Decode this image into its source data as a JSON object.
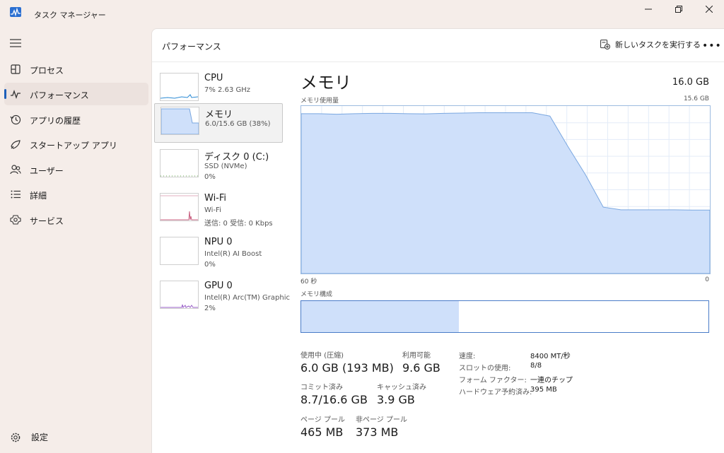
{
  "window": {
    "title": "タスク マネージャー",
    "controls": [
      "minimize-icon",
      "restore-icon",
      "close-icon"
    ]
  },
  "sidebar": {
    "items": [
      {
        "label": "プロセス",
        "icon": "processes-icon"
      },
      {
        "label": "パフォーマンス",
        "icon": "performance-icon"
      },
      {
        "label": "アプリの履歴",
        "icon": "history-icon"
      },
      {
        "label": "スタートアップ アプリ",
        "icon": "startup-icon"
      },
      {
        "label": "ユーザー",
        "icon": "users-icon"
      },
      {
        "label": "詳細",
        "icon": "details-icon"
      },
      {
        "label": "サービス",
        "icon": "services-icon"
      }
    ],
    "active_index": 1,
    "settings_label": "設定"
  },
  "header": {
    "title": "パフォーマンス",
    "new_task_label": "新しいタスクを実行する",
    "more_label": "•••"
  },
  "resources": [
    {
      "name": "CPU",
      "sub": "7%  2.63 GHz",
      "sub2": ""
    },
    {
      "name": "メモリ",
      "sub": "6.0/15.6 GB (38%)",
      "sub2": ""
    },
    {
      "name": "ディスク 0 (C:)",
      "sub": "SSD (NVMe)",
      "sub2": "0%"
    },
    {
      "name": "Wi-Fi",
      "sub": "Wi-Fi",
      "sub2": "送信: 0  受信: 0 Kbps"
    },
    {
      "name": "NPU 0",
      "sub": "Intel(R) AI Boost",
      "sub2": "0%"
    },
    {
      "name": "GPU 0",
      "sub": "Intel(R) Arc(TM) Graphic",
      "sub2": "2%"
    }
  ],
  "detail": {
    "title": "メモリ",
    "total": "16.0 GB",
    "usage_label": "メモリ使用量",
    "usage_max": "15.6 GB",
    "x_left": "60 秒",
    "x_right": "0",
    "composition_label": "メモリ構成",
    "usage_series": [
      0.954,
      0.954,
      0.951,
      0.954,
      0.956,
      0.956,
      0.954,
      0.953,
      0.956,
      0.958,
      0.96,
      0.96,
      0.96,
      0.96,
      0.94,
      0.76,
      0.59,
      0.396,
      0.38,
      0.38,
      0.38,
      0.38,
      0.379,
      0.379
    ],
    "composition": [
      0.387,
      0.252,
      0.361
    ],
    "stats": {
      "in_use_label": "使用中 (圧縮)",
      "in_use_value": "6.0 GB (193 MB)",
      "available_label": "利用可能",
      "available_value": "9.6 GB",
      "committed_label": "コミット済み",
      "committed_value": "8.7/16.6 GB",
      "cached_label": "キャッシュ済み",
      "cached_value": "3.9 GB",
      "paged_label": "ページ プール",
      "paged_value": "465 MB",
      "nonpaged_label": "非ページ プール",
      "nonpaged_value": "373 MB"
    },
    "specs": [
      {
        "key": "速度:",
        "value": "8400 MT/秒"
      },
      {
        "key": "スロットの使用:",
        "value": "8/8"
      },
      {
        "key": "フォーム ファクター:",
        "value": "一連のチップ"
      },
      {
        "key": "ハードウェア予約済み:",
        "value": "395 MB"
      }
    ]
  },
  "colors": {
    "accent": "#1d5fb9",
    "memory_fill": "#cfe0fa",
    "memory_line": "#7aa7e0",
    "composition_border": "#4a7cc8",
    "cpu_line": "#2a8ad4",
    "wifi_line": "#c86080",
    "gpu_line": "#9a60c8"
  }
}
